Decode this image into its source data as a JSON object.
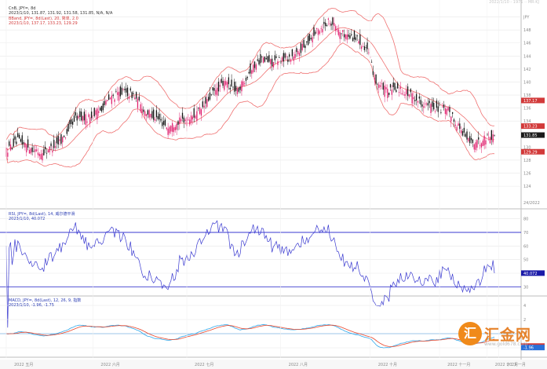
{
  "top_right_text": "2022/1/10 - 1971 ·· MR·KJ",
  "chart_data": {
    "type": "candlestick",
    "price_panel": {
      "header": [
        "CnB, JPY=, 8d",
        "2023/1/10, 131.87, 131.92, 131.58, 131.85, N/A, N/A",
        "BBand, JPY=, 8d(Last), 20, 简单, 2.0",
        "2023/1/10, 137.17, 133.23, 129.29"
      ],
      "y_ticks": [
        {
          "v": 150,
          "label": "JPY"
        },
        {
          "v": 148,
          "label": "148"
        },
        {
          "v": 146,
          "label": "146"
        },
        {
          "v": 144,
          "label": "144"
        },
        {
          "v": 142,
          "label": "142"
        },
        {
          "v": 140,
          "label": "140"
        },
        {
          "v": 138,
          "label": "138"
        },
        {
          "v": 136,
          "label": "136"
        },
        {
          "v": 134,
          "label": "134"
        },
        {
          "v": 130,
          "label": "130"
        },
        {
          "v": 128,
          "label": "128"
        },
        {
          "v": 126,
          "label": "126"
        },
        {
          "v": 124,
          "label": "124"
        }
      ],
      "ylim": [
        121,
        152
      ],
      "bottom_right_label": "24/2022",
      "price_tags": [
        {
          "v": 137.17,
          "label": "137.17",
          "color": "#d23a3a"
        },
        {
          "v": 133.23,
          "label": "133.23",
          "color": "#d23a3a"
        },
        {
          "v": 131.85,
          "label": "131.85",
          "color": "#1a1a1a"
        },
        {
          "v": 129.29,
          "label": "129.29",
          "color": "#d23a3a"
        }
      ],
      "anchors": [
        [
          0,
          129.5
        ],
        [
          8,
          131.0
        ],
        [
          16,
          130.0
        ],
        [
          24,
          129.0
        ],
        [
          32,
          130.0
        ],
        [
          40,
          131.5
        ],
        [
          48,
          134.5
        ],
        [
          56,
          134.5
        ],
        [
          64,
          135.5
        ],
        [
          72,
          137.5
        ],
        [
          80,
          138.5
        ],
        [
          88,
          138.0
        ],
        [
          96,
          135.5
        ],
        [
          104,
          134.5
        ],
        [
          112,
          133.0
        ],
        [
          120,
          134.0
        ],
        [
          128,
          134.5
        ],
        [
          136,
          136.0
        ],
        [
          144,
          138.5
        ],
        [
          152,
          140.0
        ],
        [
          160,
          138.5
        ],
        [
          168,
          141.5
        ],
        [
          176,
          143.5
        ],
        [
          184,
          143.0
        ],
        [
          192,
          143.5
        ],
        [
          200,
          144.0
        ],
        [
          208,
          146.0
        ],
        [
          216,
          148.0
        ],
        [
          224,
          149.5
        ],
        [
          232,
          147.5
        ],
        [
          238,
          147.0
        ],
        [
          244,
          146.5
        ],
        [
          250,
          145.0
        ],
        [
          256,
          140.0
        ],
        [
          264,
          138.5
        ],
        [
          272,
          139.0
        ],
        [
          280,
          138.0
        ],
        [
          290,
          136.5
        ],
        [
          298,
          136.0
        ],
        [
          306,
          135.5
        ],
        [
          314,
          133.0
        ],
        [
          320,
          131.0
        ],
        [
          326,
          130.5
        ],
        [
          332,
          131.5
        ],
        [
          338,
          131.85
        ]
      ],
      "bollinger": {
        "period": 20,
        "mult": 2.0
      }
    },
    "rsi_panel": {
      "header": [
        "RSI, JPY=, 8d(Last), 14, 威尔德平滑",
        "2023/1/10, 40.072"
      ],
      "y_ticks": [
        {
          "v": 80,
          "label": "80"
        },
        {
          "v": 70,
          "label": "70"
        },
        {
          "v": 60,
          "label": "60"
        },
        {
          "v": 50,
          "label": "50"
        },
        {
          "v": 40,
          "label": "40"
        },
        {
          "v": 30,
          "label": "30"
        }
      ],
      "ylim": [
        25,
        85
      ],
      "levels": [
        70,
        30
      ],
      "last_tag": "40.072"
    },
    "macd_panel": {
      "header": [
        "MACD, JPY=, 8d(Last), 12, 26, 9, 指数",
        "2023/1/10, -1.96, -1.75"
      ],
      "y_ticks": [
        {
          "v": 4,
          "label": "4"
        },
        {
          "v": 2,
          "label": "2"
        },
        {
          "v": 0,
          "label": "0"
        },
        {
          "v": -2,
          "label": "-2"
        }
      ],
      "ylim": [
        -3,
        5
      ],
      "zero_line": 0,
      "right_tags": [
        {
          "v": -1.75,
          "label": "-1.75",
          "color": "#d23a3a"
        },
        {
          "v": -1.96,
          "label": "-1.96",
          "color": "#2a6fd8"
        }
      ]
    },
    "x_labels": [
      {
        "i": 0,
        "label": "2022 五月"
      },
      {
        "i": 60,
        "label": "2022 六月"
      },
      {
        "i": 125,
        "label": "2022 七月"
      },
      {
        "i": 190,
        "label": "2022 八月"
      },
      {
        "i": 252,
        "label": "2022 十月"
      },
      {
        "i": 300,
        "label": "2022 十一月"
      },
      {
        "i": 333,
        "label": "2022 十二月"
      },
      {
        "i": 341,
        "label": "2023 一月"
      }
    ],
    "colors": {
      "bull": "#e0206e",
      "bear": "#111111",
      "band": "#ef7070",
      "rsi": "#3a3ad0",
      "macd": "#2ea7ea",
      "signal": "#e8452a",
      "level": "#3a3ad0",
      "axis": "#888888",
      "grid": "#e8e8e8"
    }
  },
  "watermark": {
    "badge": "汇",
    "text": "汇金网",
    "url": "www.gold678.com"
  }
}
